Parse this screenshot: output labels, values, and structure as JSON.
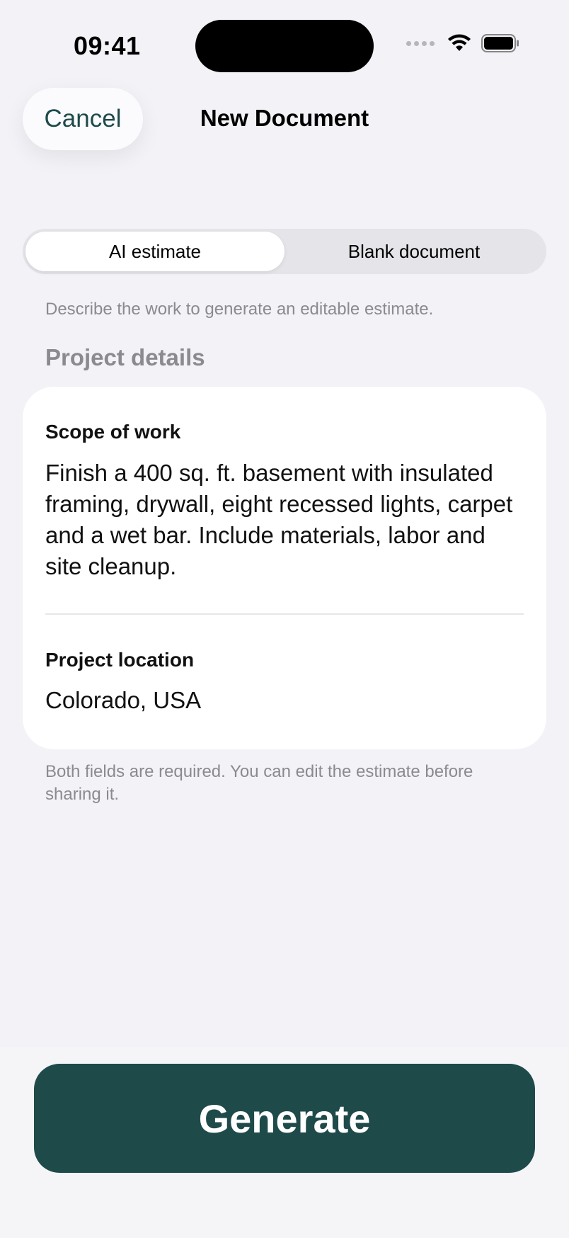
{
  "status_bar": {
    "time": "09:41",
    "icons": [
      "signal-dots-icon",
      "wifi-icon",
      "battery-icon"
    ]
  },
  "nav": {
    "cancel_label": "Cancel",
    "title": "New Document"
  },
  "segmented": {
    "options": [
      "AI estimate",
      "Blank document"
    ],
    "selected": "AI estimate"
  },
  "hint": "Describe the work to generate an editable estimate.",
  "section_title": "Project details",
  "form": {
    "scope": {
      "label": "Scope of work",
      "value": "Finish a 400 sq. ft. basement with insulated framing, drywall, eight recessed lights, carpet and a wet bar. Include materials, labor and site cleanup."
    },
    "location": {
      "label": "Project location",
      "value": "Colorado, USA"
    }
  },
  "footnote": "Both fields are required. You can edit the estimate before sharing it.",
  "actions": {
    "generate_label": "Generate"
  },
  "colors": {
    "accent": "#1f4a4a",
    "background": "#f2f2f7",
    "secondary_text": "#8a8a8f"
  }
}
